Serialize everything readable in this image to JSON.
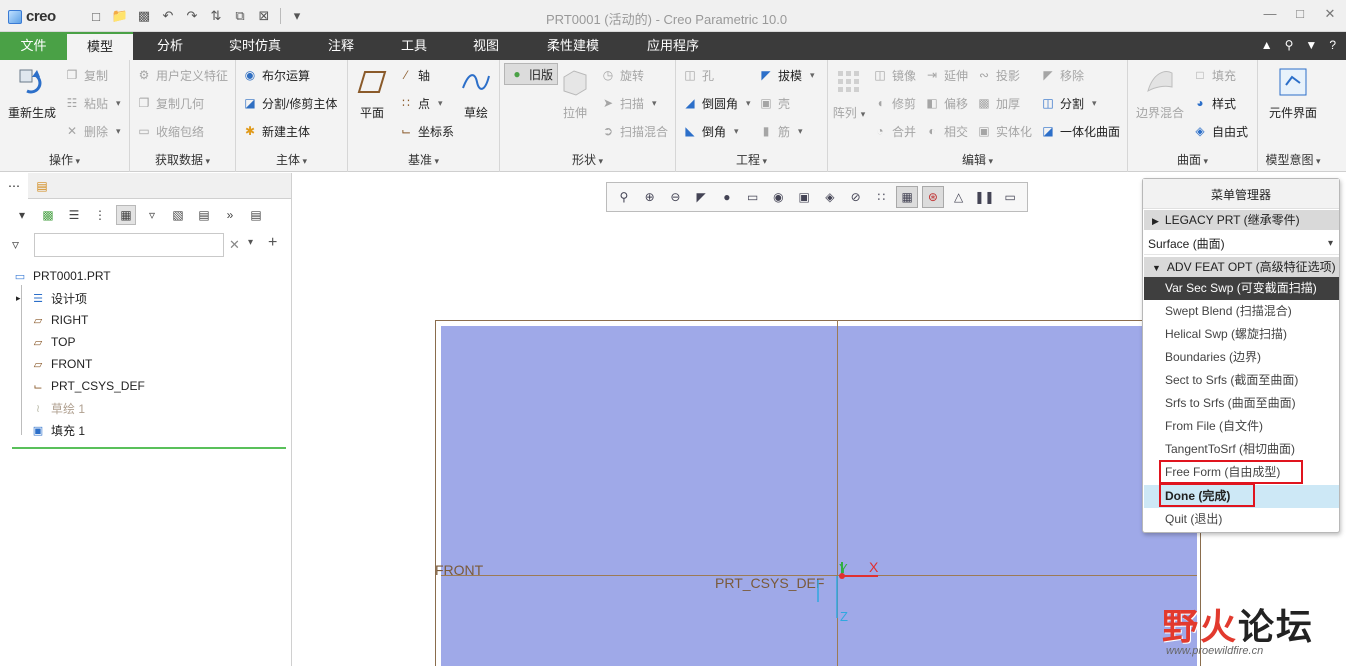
{
  "titlebar": {
    "logo": "creo",
    "title": "PRT0001 (活动的) - Creo Parametric 10.0"
  },
  "tabs": [
    "文件",
    "模型",
    "分析",
    "实时仿真",
    "注释",
    "工具",
    "视图",
    "柔性建模",
    "应用程序"
  ],
  "ribbon": {
    "ops": {
      "title": "操作",
      "regen": "重新生成",
      "copy": "复制",
      "paste": "粘贴",
      "delete": "删除"
    },
    "getdata": {
      "title": "获取数据",
      "udf": "用户定义特征",
      "copygeom": "复制几何",
      "shrinkwrap": "收缩包络"
    },
    "body": {
      "title": "主体",
      "boolean": "布尔运算",
      "split": "分割/修剪主体",
      "newbody": "新建主体"
    },
    "datum": {
      "title": "基准",
      "plane": "平面",
      "axis": "轴",
      "point": "点",
      "csys": "坐标系",
      "sketch": "草绘"
    },
    "shapes": {
      "title": "形状",
      "legacy": "旧版",
      "extrude": "拉伸",
      "revolve": "旋转",
      "sweep": "扫描",
      "sweptblend": "扫描混合"
    },
    "eng": {
      "title": "工程",
      "hole": "孔",
      "draft": "拔模",
      "round": "倒圆角",
      "shell": "壳",
      "chamfer": "倒角",
      "rib": "筋"
    },
    "edit": {
      "title": "编辑",
      "pattern": "阵列",
      "mirror": "镜像",
      "extend": "延伸",
      "project": "投影",
      "trim": "修剪",
      "offset": "偏移",
      "thicken": "加厚",
      "merge": "合并",
      "intersect": "相交",
      "solidify": "实体化",
      "remove": "移除",
      "split": "分割",
      "unify": "一体化曲面"
    },
    "surfaces": {
      "title": "曲面",
      "boundary": "边界混合",
      "fill": "填充",
      "style": "样式",
      "freestyle": "自由式"
    },
    "intent": {
      "title": "模型意图",
      "component": "元件界面"
    }
  },
  "tree": {
    "root": "PRT0001.PRT",
    "items": [
      "设计项",
      "RIGHT",
      "TOP",
      "FRONT",
      "PRT_CSYS_DEF",
      "草绘 1",
      "填充 1"
    ]
  },
  "graphics": {
    "front_label": "FRONT",
    "csys_label": "PRT_CSYS_DEF",
    "x_label": "X",
    "y_label": "Y",
    "z_label": "Z"
  },
  "menu": {
    "title": "菜单管理器",
    "legacy": "LEGACY PRT (继承零件)",
    "selected": "Surface (曲面)",
    "adv": "ADV FEAT OPT (高级特征选项)",
    "items": [
      "Var Sec Swp (可变截面扫描)",
      "Swept Blend (扫描混合)",
      "Helical Swp (螺旋扫描)",
      "Boundaries (边界)",
      "Sect to Srfs (截面至曲面)",
      "Srfs to Srfs (曲面至曲面)",
      "From File (自文件)",
      "TangentToSrf (相切曲面)",
      "Free Form (自由成型)",
      "Done (完成)",
      "Quit (退出)"
    ]
  },
  "watermark": {
    "main_a": "野火",
    "main_b": "论坛",
    "url": "www.proewildfire.cn"
  },
  "colors": {
    "accent": "#4aa146",
    "plane": "#9fa9e8",
    "highlight": "#e0141e"
  }
}
